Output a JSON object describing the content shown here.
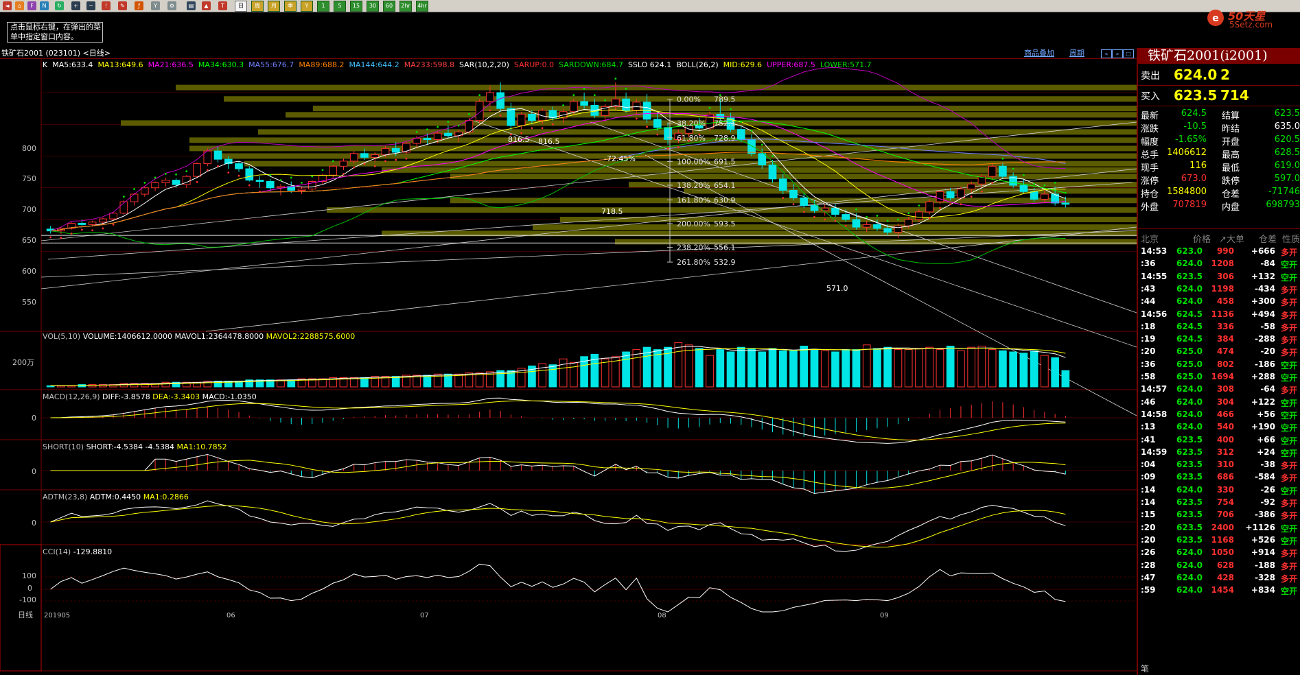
{
  "toolbar": {
    "periods": [
      "日",
      "周",
      "月",
      "季",
      "1",
      "5",
      "15",
      "30",
      "60",
      "2hr",
      "4hr",
      "Y"
    ],
    "active": "日"
  },
  "tip": "点击鼠标右键，在弹出的菜单中指定窗口内容。",
  "logo": {
    "brand": "50天星",
    "domain": "5Setz.com"
  },
  "titlebar": {
    "symbol": "铁矿石2001 (023101) <日线>",
    "link1": "商品叠加",
    "link2": "周期"
  },
  "main_indicators": [
    {
      "text": "K",
      "color": "#ffffff"
    },
    {
      "text": "MA5:633.4",
      "color": "#ffffff"
    },
    {
      "text": "MA13:649.6",
      "color": "#ffff00"
    },
    {
      "text": "MA21:636.5",
      "color": "#ff00ff"
    },
    {
      "text": "MA34:630.3",
      "color": "#00ff00"
    },
    {
      "text": "MA55:676.7",
      "color": "#6f7fff"
    },
    {
      "text": "MA89:688.2",
      "color": "#ff8000"
    },
    {
      "text": "MA144:644.2",
      "color": "#40c0ff"
    },
    {
      "text": "MA233:598.8",
      "color": "#ff4040"
    },
    {
      "text": "SAR(10,2,20)",
      "color": "#ffffff"
    },
    {
      "text": "SARUP:0.0",
      "color": "#ff3030"
    },
    {
      "text": "SARDOWN:684.7",
      "color": "#00e000"
    },
    {
      "text": "SSLO 624.1",
      "color": "#ffffff"
    },
    {
      "text": "BOLL(26,2)",
      "color": "#ffffff"
    },
    {
      "text": "MID:629.6",
      "color": "#ffff00"
    },
    {
      "text": "UPPER:687.5",
      "color": "#ff00ff"
    },
    {
      "text": "LOWER:571.7",
      "color": "#00e000"
    }
  ],
  "price_axis": [
    "800",
    "750",
    "700",
    "650",
    "600",
    "550"
  ],
  "annotations": {
    "high1": "816.5",
    "high2": "816.5",
    "low1": "718.5",
    "low2": "571.0",
    "pct": "-72.45%"
  },
  "fib": [
    {
      "pct": "0.00%",
      "val": "789.5"
    },
    {
      "pct": "38.20%",
      "val": "752.1"
    },
    {
      "pct": "61.80%",
      "val": "728.9"
    },
    {
      "pct": "100.00%",
      "val": "691.5"
    },
    {
      "pct": "138.20%",
      "val": "654.1"
    },
    {
      "pct": "161.80%",
      "val": "630.9"
    },
    {
      "pct": "200.00%",
      "val": "593.5"
    },
    {
      "pct": "238.20%",
      "val": "556.1"
    },
    {
      "pct": "261.80%",
      "val": "532.9"
    }
  ],
  "vol_panel": {
    "label": "VOL(5,10)",
    "volume": "VOLUME:1406612.0000",
    "mavol1": "MAVOL1:2364478.8000",
    "mavol2": "MAVOL2:2288575.6000",
    "axis": "200万"
  },
  "macd_panel": {
    "label": "MACD(12,26,9)",
    "diff": "DIFF:-3.8578",
    "dea": "DEA:-3.3403",
    "macd": "MACD:-1.0350",
    "axis": "0"
  },
  "short_panel": {
    "label": "SHORT(10)",
    "short": "SHORT:-4.5384",
    "val": "-4.5384",
    "ma1": "MA1:10.7852",
    "axis": "0"
  },
  "adtm_panel": {
    "label": "ADTM(23,8)",
    "adtm": "ADTM:0.4450",
    "ma1": "MA1:0.2866",
    "axis": "0"
  },
  "cci_panel": {
    "label": "CCI(14)",
    "val": "-129.8810",
    "axis": [
      "100",
      "0",
      "-100"
    ]
  },
  "date_axis": {
    "period": "日线",
    "labels": [
      "201905",
      "06",
      "07",
      "08",
      "09"
    ]
  },
  "quote": {
    "title": "铁矿石2001(i2001)",
    "sell": {
      "label": "卖出",
      "price": "624.0",
      "vol": "2"
    },
    "buy": {
      "label": "买入",
      "price": "623.5",
      "vol": "714"
    },
    "info": [
      {
        "k1": "最新",
        "v1": "624.5",
        "c1": "dn",
        "k2": "结算",
        "v2": "623.5",
        "c2": "dn"
      },
      {
        "k1": "涨跌",
        "v1": "-10.5",
        "c1": "dn",
        "k2": "昨结",
        "v2": "635.0",
        "c2": "wh"
      },
      {
        "k1": "幅度",
        "v1": "-1.65%",
        "c1": "dn",
        "k2": "开盘",
        "v2": "620.5",
        "c2": "dn"
      },
      {
        "k1": "总手",
        "v1": "1406612",
        "c1": "yl",
        "k2": "最高",
        "v2": "628.5",
        "c2": "dn"
      },
      {
        "k1": "现手",
        "v1": "116",
        "c1": "yl",
        "k2": "最低",
        "v2": "619.0",
        "c2": "dn"
      },
      {
        "k1": "涨停",
        "v1": "673.0",
        "c1": "up",
        "k2": "跌停",
        "v2": "597.0",
        "c2": "dn"
      },
      {
        "k1": "持仓",
        "v1": "1584800",
        "c1": "yl",
        "k2": "仓差",
        "v2": "-71746",
        "c2": "dn"
      },
      {
        "k1": "外盘",
        "v1": "707819",
        "c1": "up",
        "k2": "内盘",
        "v2": "698793",
        "c2": "dn"
      }
    ],
    "ticks_header": {
      "loc": "北京",
      "price": "价格",
      "vol": "↗大单",
      "oi": "仓差",
      "nature": "性质"
    },
    "ticks": [
      {
        "t": "14:53",
        "p": "623.0",
        "v": "990",
        "o": "+666",
        "n": "多开",
        "tc": "wh",
        "nc": "up"
      },
      {
        "t": ":36",
        "p": "624.0",
        "v": "1208",
        "o": "-84",
        "n": "空开",
        "tc": "wh",
        "nc": "dn"
      },
      {
        "t": "14:55",
        "p": "623.5",
        "v": "306",
        "o": "+132",
        "n": "空开",
        "tc": "wh",
        "nc": "dn"
      },
      {
        "t": ":43",
        "p": "624.0",
        "v": "1198",
        "o": "-434",
        "n": "多开",
        "tc": "wh",
        "nc": "up"
      },
      {
        "t": ":44",
        "p": "624.0",
        "v": "458",
        "o": "+300",
        "n": "多开",
        "tc": "wh",
        "nc": "up"
      },
      {
        "t": "14:56",
        "p": "624.5",
        "v": "1136",
        "o": "+494",
        "n": "多开",
        "tc": "wh",
        "nc": "up"
      },
      {
        "t": ":18",
        "p": "624.5",
        "v": "336",
        "o": "-58",
        "n": "多开",
        "tc": "wh",
        "nc": "up"
      },
      {
        "t": ":19",
        "p": "624.5",
        "v": "384",
        "o": "-288",
        "n": "多开",
        "tc": "wh",
        "nc": "up"
      },
      {
        "t": ":20",
        "p": "625.0",
        "v": "474",
        "o": "-20",
        "n": "多开",
        "tc": "wh",
        "nc": "up"
      },
      {
        "t": ":36",
        "p": "625.0",
        "v": "802",
        "o": "-186",
        "n": "空开",
        "tc": "wh",
        "nc": "dn"
      },
      {
        "t": ":58",
        "p": "625.0",
        "v": "1694",
        "o": "+288",
        "n": "空开",
        "tc": "wh",
        "nc": "dn"
      },
      {
        "t": "14:57",
        "p": "624.0",
        "v": "308",
        "o": "-64",
        "n": "多开",
        "tc": "wh",
        "nc": "up"
      },
      {
        "t": ":46",
        "p": "624.0",
        "v": "304",
        "o": "+122",
        "n": "空开",
        "tc": "wh",
        "nc": "dn"
      },
      {
        "t": "14:58",
        "p": "624.0",
        "v": "466",
        "o": "+56",
        "n": "空开",
        "tc": "wh",
        "nc": "dn"
      },
      {
        "t": ":13",
        "p": "624.0",
        "v": "540",
        "o": "+190",
        "n": "空开",
        "tc": "wh",
        "nc": "dn"
      },
      {
        "t": ":41",
        "p": "623.5",
        "v": "400",
        "o": "+66",
        "n": "空开",
        "tc": "wh",
        "nc": "dn"
      },
      {
        "t": "14:59",
        "p": "623.5",
        "v": "312",
        "o": "+24",
        "n": "空开",
        "tc": "wh",
        "nc": "dn"
      },
      {
        "t": ":04",
        "p": "623.5",
        "v": "310",
        "o": "-38",
        "n": "多开",
        "tc": "wh",
        "nc": "up"
      },
      {
        "t": ":09",
        "p": "623.5",
        "v": "686",
        "o": "-584",
        "n": "多开",
        "tc": "wh",
        "nc": "up"
      },
      {
        "t": ":14",
        "p": "624.0",
        "v": "330",
        "o": "-26",
        "n": "空开",
        "tc": "wh",
        "nc": "dn"
      },
      {
        "t": ":14",
        "p": "623.5",
        "v": "754",
        "o": "-92",
        "n": "多开",
        "tc": "wh",
        "nc": "up"
      },
      {
        "t": ":15",
        "p": "623.5",
        "v": "706",
        "o": "-386",
        "n": "多开",
        "tc": "wh",
        "nc": "up"
      },
      {
        "t": ":20",
        "p": "623.5",
        "v": "2400",
        "o": "+1126",
        "n": "空开",
        "tc": "wh",
        "nc": "dn"
      },
      {
        "t": ":20",
        "p": "623.5",
        "v": "1168",
        "o": "+526",
        "n": "空开",
        "tc": "wh",
        "nc": "dn"
      },
      {
        "t": ":26",
        "p": "624.0",
        "v": "1050",
        "o": "+914",
        "n": "多开",
        "tc": "wh",
        "nc": "up"
      },
      {
        "t": ":28",
        "p": "624.0",
        "v": "628",
        "o": "-188",
        "n": "多开",
        "tc": "wh",
        "nc": "up"
      },
      {
        "t": ":47",
        "p": "624.0",
        "v": "428",
        "o": "-328",
        "n": "多开",
        "tc": "wh",
        "nc": "up"
      },
      {
        "t": ":59",
        "p": "624.0",
        "v": "1454",
        "o": "+834",
        "n": "空开",
        "tc": "wh",
        "nc": "dn"
      }
    ],
    "footer": "笔"
  },
  "colors": {
    "up": "#ff3030",
    "down": "#00e5e5",
    "border": "#7a0000",
    "bg": "#000000",
    "text": "#c0c0c0",
    "accent": "#ffff00"
  },
  "chart_data": {
    "type": "candlestick",
    "title": "铁矿石2001 (023101) <日线>",
    "ylim": [
      520,
      840
    ],
    "x_labels": [
      "201905",
      "06",
      "07",
      "08",
      "09"
    ],
    "ohlc": [
      [
        585,
        590,
        578,
        582
      ],
      [
        582,
        588,
        577,
        586
      ],
      [
        586,
        596,
        584,
        594
      ],
      [
        594,
        600,
        590,
        592
      ],
      [
        592,
        598,
        589,
        596
      ],
      [
        596,
        603,
        592,
        601
      ],
      [
        601,
        612,
        598,
        610
      ],
      [
        610,
        630,
        608,
        628
      ],
      [
        628,
        642,
        622,
        640
      ],
      [
        640,
        652,
        636,
        650
      ],
      [
        650,
        660,
        645,
        658
      ],
      [
        658,
        666,
        652,
        662
      ],
      [
        662,
        665,
        650,
        655
      ],
      [
        655,
        670,
        650,
        668
      ],
      [
        668,
        690,
        665,
        688
      ],
      [
        688,
        712,
        684,
        708
      ],
      [
        708,
        715,
        690,
        695
      ],
      [
        695,
        700,
        680,
        688
      ],
      [
        688,
        692,
        675,
        680
      ],
      [
        680,
        684,
        660,
        662
      ],
      [
        662,
        668,
        650,
        660
      ],
      [
        660,
        664,
        645,
        650
      ],
      [
        650,
        656,
        638,
        652
      ],
      [
        652,
        660,
        642,
        646
      ],
      [
        646,
        652,
        640,
        648
      ],
      [
        648,
        662,
        645,
        660
      ],
      [
        660,
        672,
        656,
        670
      ],
      [
        670,
        686,
        666,
        684
      ],
      [
        684,
        696,
        678,
        692
      ],
      [
        692,
        708,
        688,
        704
      ],
      [
        704,
        712,
        694,
        698
      ],
      [
        698,
        706,
        690,
        702
      ],
      [
        702,
        716,
        698,
        712
      ],
      [
        712,
        722,
        700,
        706
      ],
      [
        706,
        724,
        702,
        720
      ],
      [
        720,
        732,
        712,
        728
      ],
      [
        728,
        736,
        718,
        726
      ],
      [
        726,
        740,
        720,
        736
      ],
      [
        736,
        748,
        728,
        732
      ],
      [
        732,
        742,
        722,
        738
      ],
      [
        738,
        760,
        734,
        756
      ],
      [
        756,
        790,
        752,
        786
      ],
      [
        786,
        810,
        778,
        800
      ],
      [
        800,
        816,
        770,
        775
      ],
      [
        775,
        784,
        740,
        748
      ],
      [
        748,
        770,
        742,
        766
      ],
      [
        766,
        772,
        750,
        756
      ],
      [
        756,
        776,
        750,
        772
      ],
      [
        772,
        778,
        756,
        760
      ],
      [
        760,
        774,
        752,
        770
      ],
      [
        770,
        790,
        765,
        786
      ],
      [
        786,
        800,
        775,
        780
      ],
      [
        780,
        790,
        760,
        764
      ],
      [
        764,
        782,
        756,
        778
      ],
      [
        778,
        816,
        772,
        790
      ],
      [
        790,
        800,
        768,
        772
      ],
      [
        772,
        790,
        765,
        785
      ],
      [
        785,
        798,
        752,
        758
      ],
      [
        758,
        770,
        740,
        745
      ],
      [
        745,
        752,
        718,
        726
      ],
      [
        726,
        742,
        720,
        736
      ],
      [
        736,
        752,
        730,
        748
      ],
      [
        748,
        760,
        740,
        744
      ],
      [
        744,
        770,
        740,
        766
      ],
      [
        766,
        790,
        756,
        760
      ],
      [
        760,
        768,
        738,
        742
      ],
      [
        742,
        748,
        722,
        726
      ],
      [
        726,
        734,
        700,
        704
      ],
      [
        704,
        712,
        680,
        686
      ],
      [
        686,
        694,
        658,
        664
      ],
      [
        664,
        672,
        640,
        646
      ],
      [
        646,
        656,
        630,
        634
      ],
      [
        634,
        642,
        618,
        622
      ],
      [
        622,
        630,
        610,
        614
      ],
      [
        614,
        624,
        606,
        618
      ],
      [
        618,
        624,
        604,
        608
      ],
      [
        608,
        616,
        596,
        600
      ],
      [
        600,
        610,
        584,
        588
      ],
      [
        588,
        598,
        580,
        592
      ],
      [
        592,
        600,
        582,
        586
      ],
      [
        586,
        592,
        575,
        580
      ],
      [
        580,
        594,
        571,
        590
      ],
      [
        590,
        604,
        586,
        600
      ],
      [
        600,
        616,
        596,
        612
      ],
      [
        612,
        632,
        608,
        628
      ],
      [
        628,
        646,
        624,
        644
      ],
      [
        644,
        650,
        630,
        634
      ],
      [
        634,
        652,
        630,
        648
      ],
      [
        648,
        660,
        642,
        656
      ],
      [
        656,
        672,
        650,
        668
      ],
      [
        668,
        688,
        664,
        684
      ],
      [
        684,
        690,
        664,
        668
      ],
      [
        668,
        674,
        650,
        654
      ],
      [
        654,
        664,
        640,
        644
      ],
      [
        644,
        650,
        628,
        632
      ],
      [
        632,
        648,
        628,
        640
      ],
      [
        640,
        652,
        622,
        626
      ],
      [
        626,
        636,
        619,
        624
      ]
    ],
    "volume_m": [
      0.1,
      0.1,
      0.1,
      0.2,
      0.2,
      0.2,
      0.2,
      0.3,
      0.3,
      0.3,
      0.3,
      0.4,
      0.4,
      0.4,
      0.4,
      0.5,
      0.5,
      0.5,
      0.5,
      0.6,
      0.6,
      0.6,
      0.6,
      0.6,
      0.7,
      0.7,
      0.7,
      0.8,
      0.8,
      0.8,
      0.8,
      0.9,
      0.9,
      0.9,
      1.0,
      1.0,
      1.0,
      1.1,
      1.1,
      1.1,
      1.2,
      1.2,
      1.3,
      1.4,
      1.4,
      1.6,
      1.8,
      2.0,
      1.9,
      2.4,
      2.1,
      2.6,
      2.8,
      2.4,
      2.6,
      3.0,
      3.2,
      3.4,
      3.2,
      3.4,
      3.8,
      3.6,
      3.3,
      2.7,
      3.2,
      3.0,
      3.4,
      3.3,
      3.0,
      3.3,
      3.1,
      3.1,
      3.5,
      3.2,
      3.1,
      3.0,
      3.2,
      3.2,
      3.6,
      3.3,
      3.4,
      3.2,
      3.2,
      3.3,
      3.4,
      3.2,
      3.5,
      3.1,
      3.4,
      3.5,
      3.2,
      3.1,
      3.0,
      2.9,
      3.1,
      2.7,
      2.5,
      1.4
    ]
  }
}
